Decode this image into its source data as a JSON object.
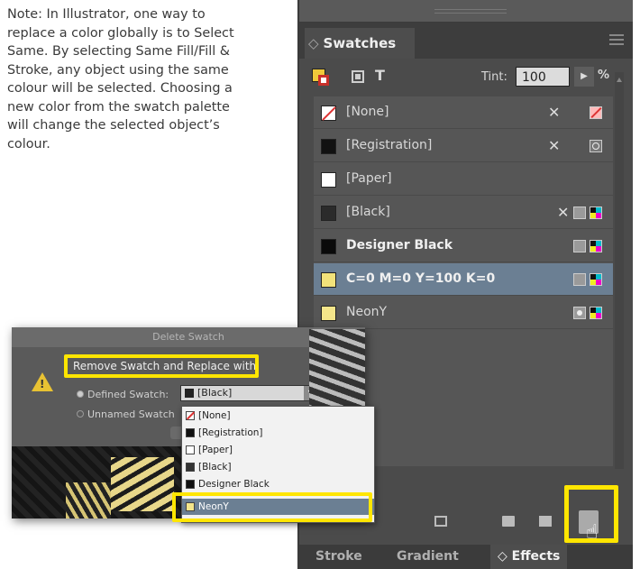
{
  "note": {
    "lines": [
      "Note: In Illustrator, one way to",
      "replace a color globally is to Select",
      "Same. By selecting Same Fill/Fill &",
      "Stroke, any object using the same",
      "colour will be selected. Choosing a",
      "new color from the swatch palette",
      "will change the selected object’s",
      "colour."
    ]
  },
  "panel": {
    "tab_label": "Swatches",
    "tint_label": "Tint:",
    "tint_value": "100",
    "tint_unit": "%",
    "swatches": [
      {
        "name": "[None]",
        "chip": "none"
      },
      {
        "name": "[Registration]",
        "chip": "#111111"
      },
      {
        "name": "[Paper]",
        "chip": "#ffffff"
      },
      {
        "name": "[Black]",
        "chip": "#2b2b2b"
      },
      {
        "name": "Designer Black",
        "chip": "#0a0a0a"
      },
      {
        "name": "C=0 M=0 Y=100 K=0",
        "chip": "#f2e27a",
        "selected": true
      },
      {
        "name": "NeonY",
        "chip": "#f4e58a"
      }
    ],
    "bottom_tabs": [
      "Stroke",
      "Gradient",
      "Effects"
    ]
  },
  "dialog": {
    "title": "Delete Swatch",
    "remove_label": "Remove Swatch and Replace with:",
    "defined_label": "Defined Swatch:",
    "unnamed_label": "Unnamed Swatch",
    "selected_value": "[Black]",
    "dropdown_items": [
      "[None]",
      "[Registration]",
      "[Paper]",
      "[Black]",
      "Designer Black",
      "NeonY"
    ]
  },
  "colors": {
    "highlight": "#ffe600",
    "selection": "#6b7f93",
    "panel_bg": "#4b4b4b"
  }
}
